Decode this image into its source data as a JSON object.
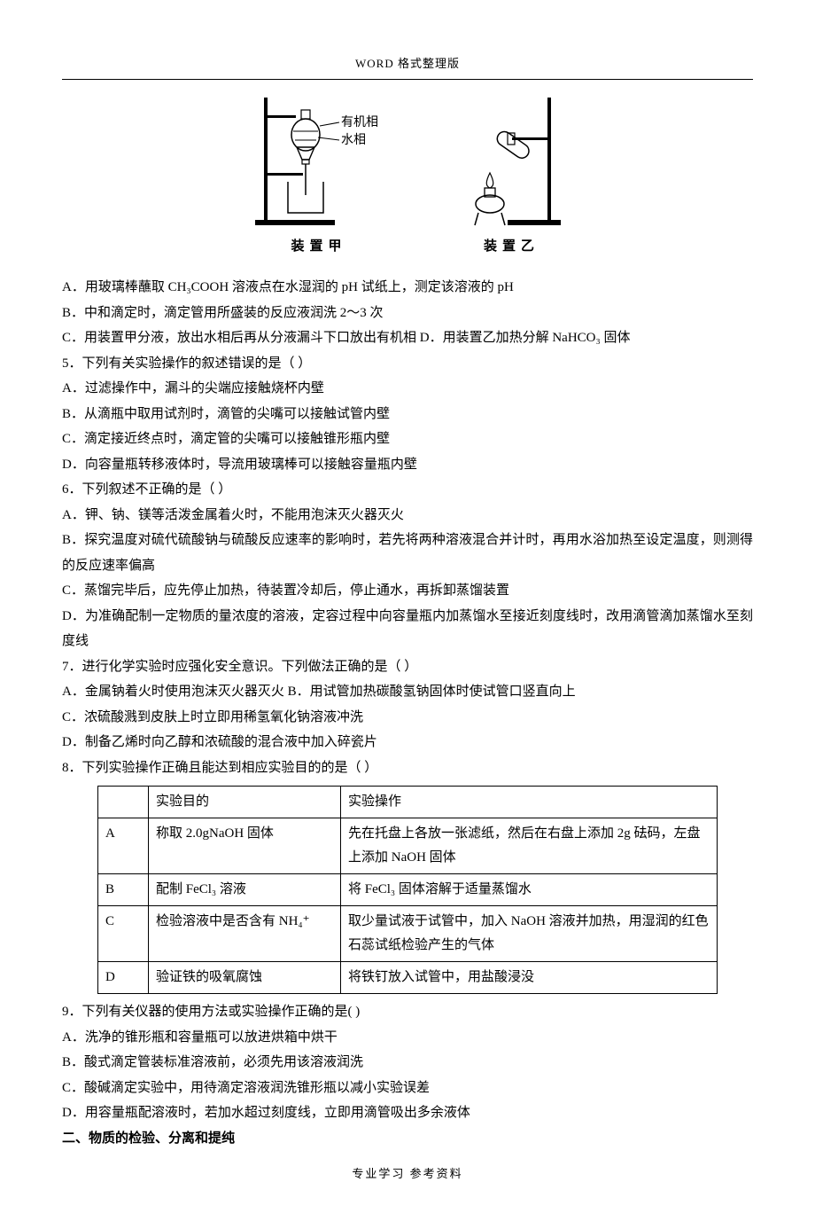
{
  "header": "WORD 格式整理版",
  "figures": {
    "labels": {
      "organic": "有机相",
      "aqueous": "水相"
    },
    "captions": {
      "a": "装置甲",
      "b": "装置乙"
    }
  },
  "lines": {
    "l1": "A．用玻璃棒蘸取 CH₃COOH 溶液点在水湿润的 pH 试纸上，测定该溶液的 pH",
    "l2": "B．中和滴定时，滴定管用所盛装的反应液润洗 2～3 次",
    "l3": "C．用装置甲分液，放出水相后再从分液漏斗下口放出有机相     D．用装置乙加热分解 NaHCO₃ 固体",
    "q5": "5．下列有关实验操作的叙述错误的是（     ）",
    "q5a": "A．过滤操作中，漏斗的尖端应接触烧杯内壁",
    "q5b": "B．从滴瓶中取用试剂时，滴管的尖嘴可以接触试管内壁",
    "q5c": "C．滴定接近终点时，滴定管的尖嘴可以接触锥形瓶内壁",
    "q5d": "D．向容量瓶转移液体时，导流用玻璃棒可以接触容量瓶内壁",
    "q6": "6．下列叙述不正确的是（     ）",
    "q6a": "A．钾、钠、镁等活泼金属着火时，不能用泡沫灭火器灭火",
    "q6b": "B．探究温度对硫代硫酸钠与硫酸反应速率的影响时，若先将两种溶液混合并计时，再用水浴加热至设定温度，则测得的反应速率偏高",
    "q6c": "C．蒸馏完毕后，应先停止加热，待装置冷却后，停止通水，再拆卸蒸馏装置",
    "q6d": "D．为准确配制一定物质的量浓度的溶液，定容过程中向容量瓶内加蒸馏水至接近刻度线时，改用滴管滴加蒸馏水至刻度线",
    "q7": "7．进行化学实验时应强化安全意识。下列做法正确的是（     ）",
    "q7a": "A．金属钠着火时使用泡沫灭火器灭火       B．用试管加热碳酸氢钠固体时使试管口竖直向上",
    "q7c": "C．浓硫酸溅到皮肤上时立即用稀氢氧化钠溶液冲洗",
    "q7d": "D．制备乙烯时向乙醇和浓硫酸的混合液中加入碎瓷片",
    "q8": "8．下列实验操作正确且能达到相应实验目的的是（       ）",
    "q9": "9．下列有关仪器的使用方法或实验操作正确的是(      )",
    "q9a": "A．洗净的锥形瓶和容量瓶可以放进烘箱中烘干",
    "q9b": "B．酸式滴定管装标准溶液前，必须先用该溶液润洗",
    "q9c": "C．酸碱滴定实验中，用待滴定溶液润洗锥形瓶以减小实验误差",
    "q9d": "D．用容量瓶配溶液时，若加水超过刻度线，立即用滴管吸出多余液体"
  },
  "table8": {
    "headers": {
      "blank": "",
      "purpose": "实验目的",
      "operation": "实验操作"
    },
    "rows": [
      {
        "key": "A",
        "purpose": "称取 2.0gNaOH 固体",
        "operation": "先在托盘上各放一张滤纸，然后在右盘上添加 2g 砝码，左盘上添加 NaOH 固体"
      },
      {
        "key": "B",
        "purpose": "配制 FeCl₃ 溶液",
        "operation": "将 FeCl₃ 固体溶解于适量蒸馏水"
      },
      {
        "key": "C",
        "purpose": "检验溶液中是否含有 NH₄⁺",
        "operation": "取少量试液于试管中，加入 NaOH 溶液并加热，用湿润的红色石蕊试纸检验产生的气体"
      },
      {
        "key": "D",
        "purpose": "验证铁的吸氧腐蚀",
        "operation": "将铁钉放入试管中，用盐酸浸没"
      }
    ]
  },
  "section2": "二、物质的检验、分离和提纯",
  "footer": "专业学习     参考资料"
}
